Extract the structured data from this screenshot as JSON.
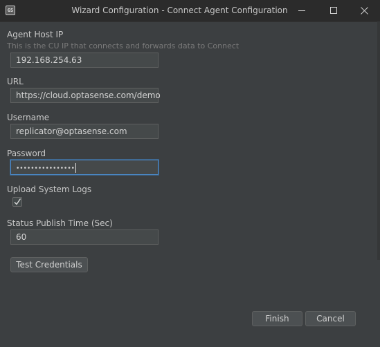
{
  "window": {
    "app_icon_text": "GS",
    "title": "Wizard Configuration - Connect Agent Configuration",
    "minimize_icon": "minimize-icon",
    "maximize_icon": "maximize-icon",
    "close_icon": "close-icon"
  },
  "form": {
    "agent_host_ip": {
      "label": "Agent Host IP",
      "hint": "This is the CU IP that connects and forwards data to Connect",
      "value": "192.168.254.63"
    },
    "url": {
      "label": "URL",
      "value": "https://cloud.optasense.com/demo"
    },
    "username": {
      "label": "Username",
      "value": "replicator@optasense.com"
    },
    "password": {
      "label": "Password",
      "masked_value": "••••••••••••••••"
    },
    "upload_system_logs": {
      "label": "Upload System Logs",
      "checked": true
    },
    "status_publish_time": {
      "label": "Status Publish Time (Sec)",
      "value": "60"
    }
  },
  "buttons": {
    "test_credentials": "Test Credentials",
    "finish": "Finish",
    "cancel": "Cancel"
  },
  "colors": {
    "background": "#3c3f41",
    "titlebar": "#2b2b2b",
    "field_bg": "#45494a",
    "focus_border": "#4a88c7",
    "text": "#c9c9c9",
    "hint_text": "#7a7a7a"
  }
}
